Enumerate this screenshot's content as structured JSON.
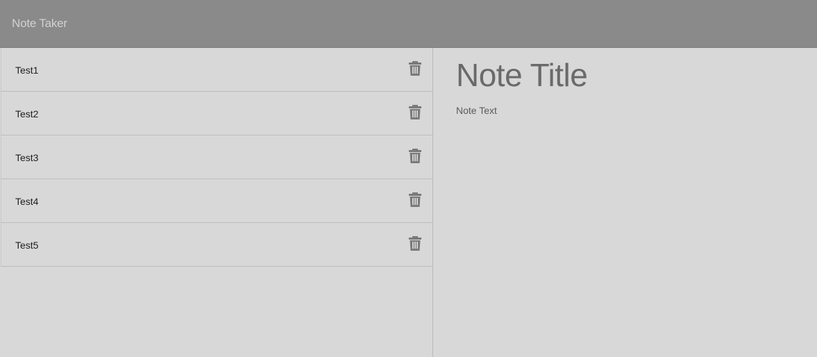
{
  "navbar": {
    "brand": "Note Taker"
  },
  "notes": [
    {
      "title": "Test1",
      "delete_icon": "trash-icon"
    },
    {
      "title": "Test2",
      "delete_icon": "trash-icon"
    },
    {
      "title": "Test3",
      "delete_icon": "trash-icon"
    },
    {
      "title": "Test4",
      "delete_icon": "trash-icon"
    },
    {
      "title": "Test5",
      "delete_icon": "trash-icon"
    }
  ],
  "editor": {
    "title_placeholder": "Note Title",
    "text_placeholder": "Note Text"
  },
  "colors": {
    "navbar": "#8a8a8a",
    "background": "#d8d8d8",
    "icon": "#7a7a7a"
  }
}
